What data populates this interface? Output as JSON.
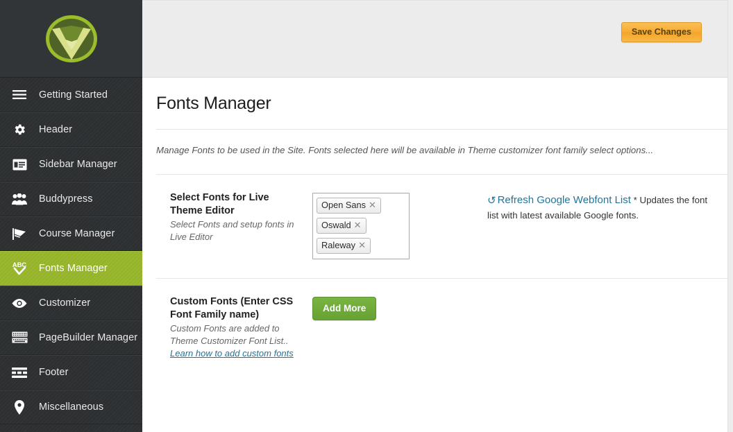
{
  "sidebar": {
    "logo_name": "v-shield-logo",
    "items": [
      {
        "label": "Getting Started",
        "icon": "hamburger-menu-icon",
        "active": false
      },
      {
        "label": "Header",
        "icon": "gear-icon",
        "active": false
      },
      {
        "label": "Sidebar Manager",
        "icon": "sidebar-layout-icon",
        "active": false
      },
      {
        "label": "Buddypress",
        "icon": "users-group-icon",
        "active": false
      },
      {
        "label": "Course Manager",
        "icon": "graduation-cap-icon",
        "active": false
      },
      {
        "label": "Fonts Manager",
        "icon": "abc-checkmark-icon",
        "active": true
      },
      {
        "label": "Customizer",
        "icon": "eye-icon",
        "active": false
      },
      {
        "label": "PageBuilder Manager",
        "icon": "keyboard-icon",
        "active": false
      },
      {
        "label": "Footer",
        "icon": "footer-layout-icon",
        "active": false
      },
      {
        "label": "Miscellaneous",
        "icon": "map-pin-icon",
        "active": false
      }
    ]
  },
  "topbar": {
    "save_label": "Save Changes"
  },
  "page": {
    "title": "Fonts Manager",
    "description": "Manage Fonts to be used in the Site. Fonts selected here will be available in Theme customizer font family select options..."
  },
  "sections": [
    {
      "title": "Select Fonts for Live Theme Editor",
      "subtitle": "Select Fonts and setup fonts in Live Editor",
      "selected_fonts": [
        "Open Sans",
        "Oswald",
        "Raleway"
      ],
      "tag_remove_glyph": "✕",
      "aside": {
        "refresh_icon": "refresh-circular-arrow-icon",
        "refresh_icon_glyph": "↺",
        "link_text": "Refresh Google Webfont List",
        "note": " * Updates the font list with latest available Google fonts."
      }
    },
    {
      "title": "Custom Fonts (Enter CSS Font Family name)",
      "subtitle_part1": "Custom Fonts are added to Theme Customizer Font List.. ",
      "subtitle_link": "Learn how to add custom fonts",
      "button_label": "Add More"
    }
  ],
  "colors": {
    "sidebar_bg": "#2f3234",
    "active_green": "#9aba2c",
    "save_orange": "#f6ab33",
    "add_more_green": "#6fa93a",
    "link_blue": "#21759b",
    "topbar_gray": "#ececec"
  }
}
